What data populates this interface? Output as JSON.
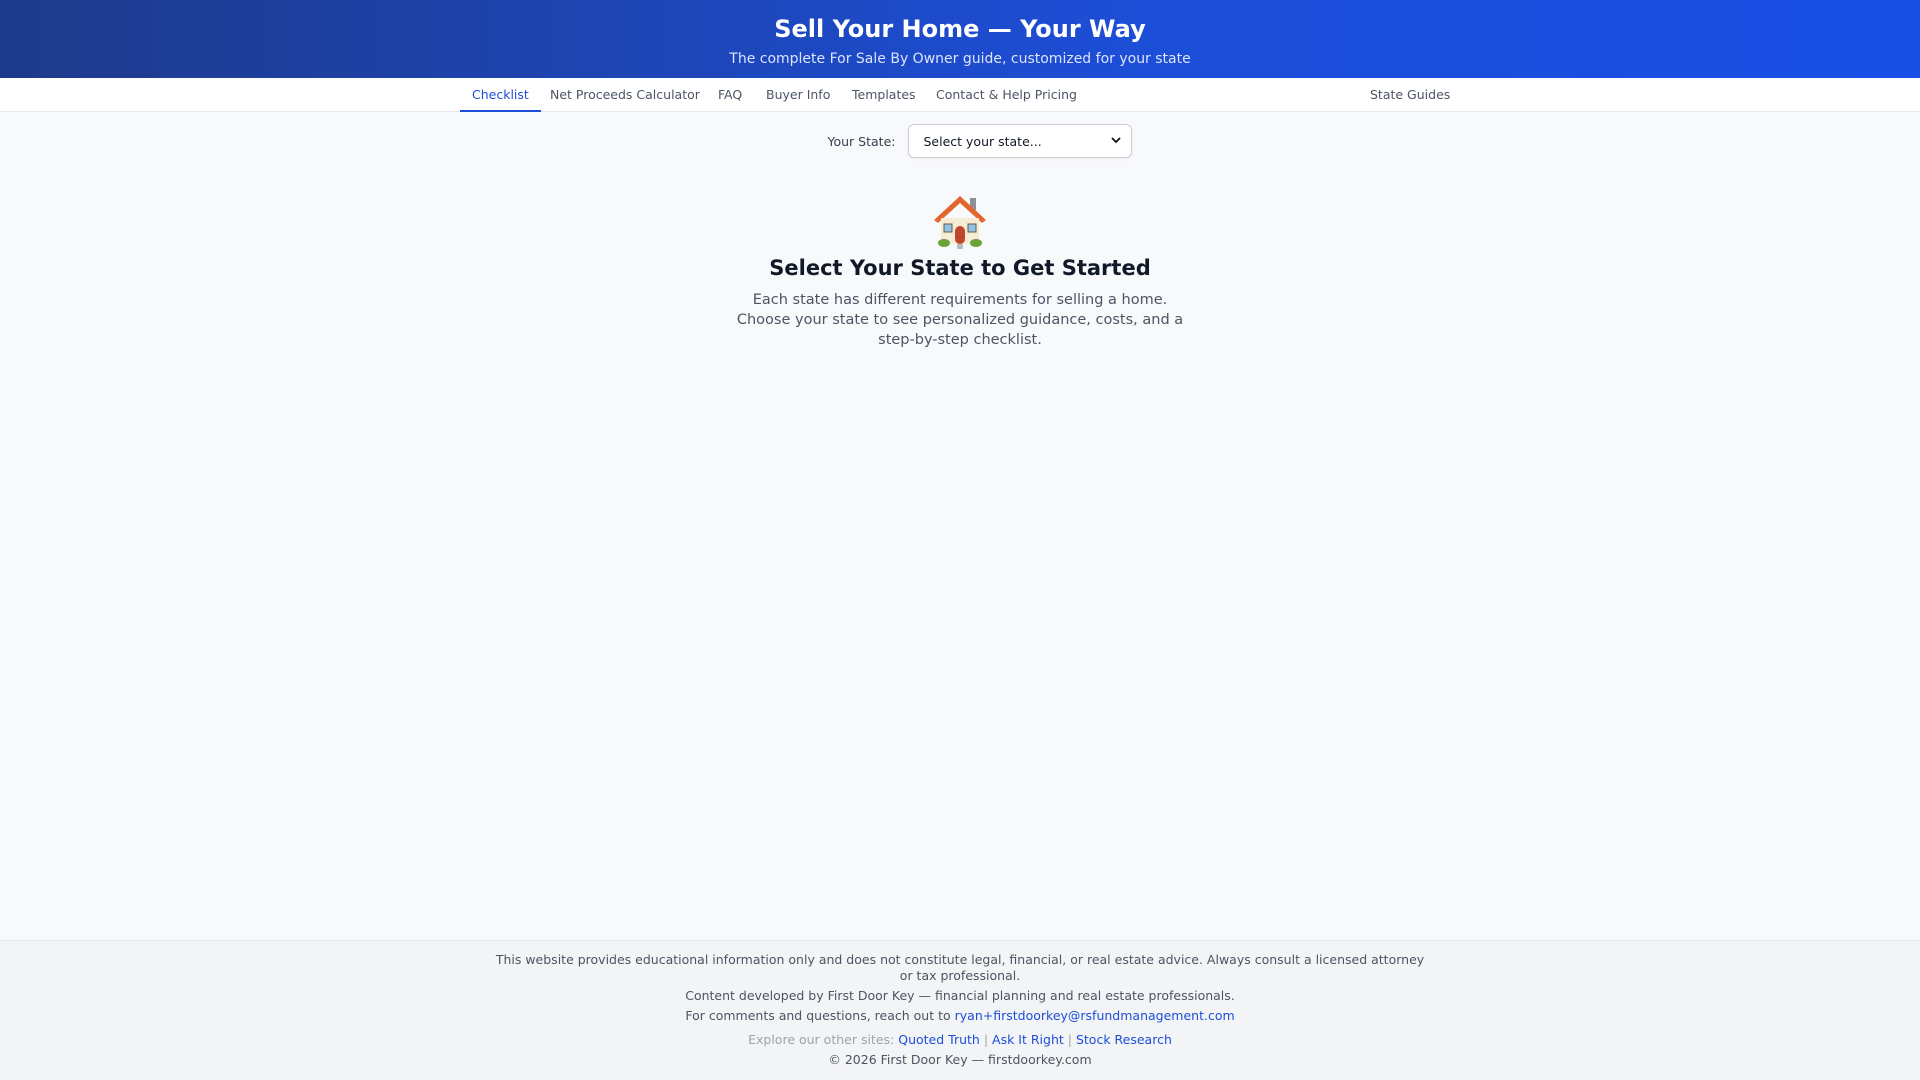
{
  "header": {
    "title": "Sell Your Home — Your Way",
    "subtitle": "The complete For Sale By Owner guide, customized for your state"
  },
  "tabs": [
    {
      "label": "Checklist",
      "active": true
    },
    {
      "label": "Net Proceeds Calculator"
    },
    {
      "label": "FAQ"
    },
    {
      "label": "Buyer Info"
    },
    {
      "label": "Templates"
    },
    {
      "label": "Contact & Help Pricing"
    },
    {
      "label": "State Guides"
    }
  ],
  "state_selector": {
    "label": "Your State:",
    "selected": "Select your state..."
  },
  "hero": {
    "icon": "house-icon",
    "title": "Select Your State to Get Started",
    "description": "Each state has different requirements for selling a home. Choose your state to see personalized guidance, costs, and a step-by-step checklist."
  },
  "footer": {
    "disclaimer": "This website provides educational information only and does not constitute legal, financial, or real estate advice. Always consult a licensed attorney or tax professional.",
    "developed_by": "Content developed by First Door Key — financial planning and real estate professionals.",
    "contact_prefix": "For comments and questions, reach out to",
    "contact_email": "ryan+firstdoorkey@rsfundmanagement.com",
    "explore_prefix": "Explore our other sites:",
    "sites": [
      "Quoted Truth",
      "Ask It Right",
      "Stock Research"
    ],
    "separator": "|",
    "copyright": "© 2026 First Door Key — firstdoorkey.com"
  },
  "colors": {
    "accent": "#1d4ed8",
    "header_start": "#1e3a8a",
    "header_end": "#1a4fe6"
  }
}
